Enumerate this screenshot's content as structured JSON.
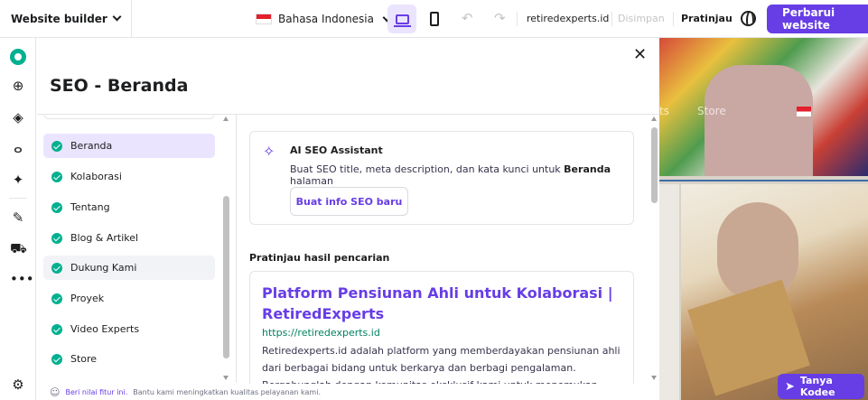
{
  "topbar": {
    "brand": "Website builder",
    "language": "Bahasa Indonesia",
    "domain": "retiredexperts.id",
    "saved": "Disimpan",
    "preview": "Pratinjau",
    "update": "Perbarui website",
    "accent": "#673de6"
  },
  "rail": {
    "icons": [
      "logo-icon",
      "add-icon",
      "layers-icon",
      "paint-icon",
      "ai-sparkle-icon",
      "edit-icon",
      "cart-icon",
      "more-icon",
      "help-icon"
    ]
  },
  "panel": {
    "title": "SEO - Beranda",
    "pages": [
      {
        "label": "Beranda"
      },
      {
        "label": "Kolaborasi"
      },
      {
        "label": "Tentang"
      },
      {
        "label": "Blog & Artikel"
      },
      {
        "label": "Dukung Kami"
      },
      {
        "label": "Proyek"
      },
      {
        "label": "Video Experts"
      },
      {
        "label": "Store"
      }
    ],
    "ai": {
      "title": "AI SEO Assistant",
      "desc_pre": "Buat SEO title, meta description, dan kata kunci untuk ",
      "desc_bold": "Beranda",
      "desc_post": " halaman",
      "button": "Buat info SEO baru"
    },
    "preview_head": "Pratinjau hasil pencarian",
    "result": {
      "title": "Platform Pensiunan Ahli untuk Kolaborasi | RetiredExperts",
      "url": "https://retiredexperts.id",
      "desc": "Retiredexperts.id adalah platform yang memberdayakan pensiunan ahli dari berbagai bidang untuk berkarya dan berbagi pengalaman. Bergabunglah dengan komunitas eksklusif kami untuk menemukan peluang kolaborasi dan interaksi."
    }
  },
  "canvas": {
    "nav": [
      "ts",
      "Store"
    ],
    "kodee": "Tanya Kodee"
  },
  "feedback": {
    "link": "Beri nilai fitur ini.",
    "text": "Bantu kami meningkatkan kualitas pelayanan kami."
  }
}
